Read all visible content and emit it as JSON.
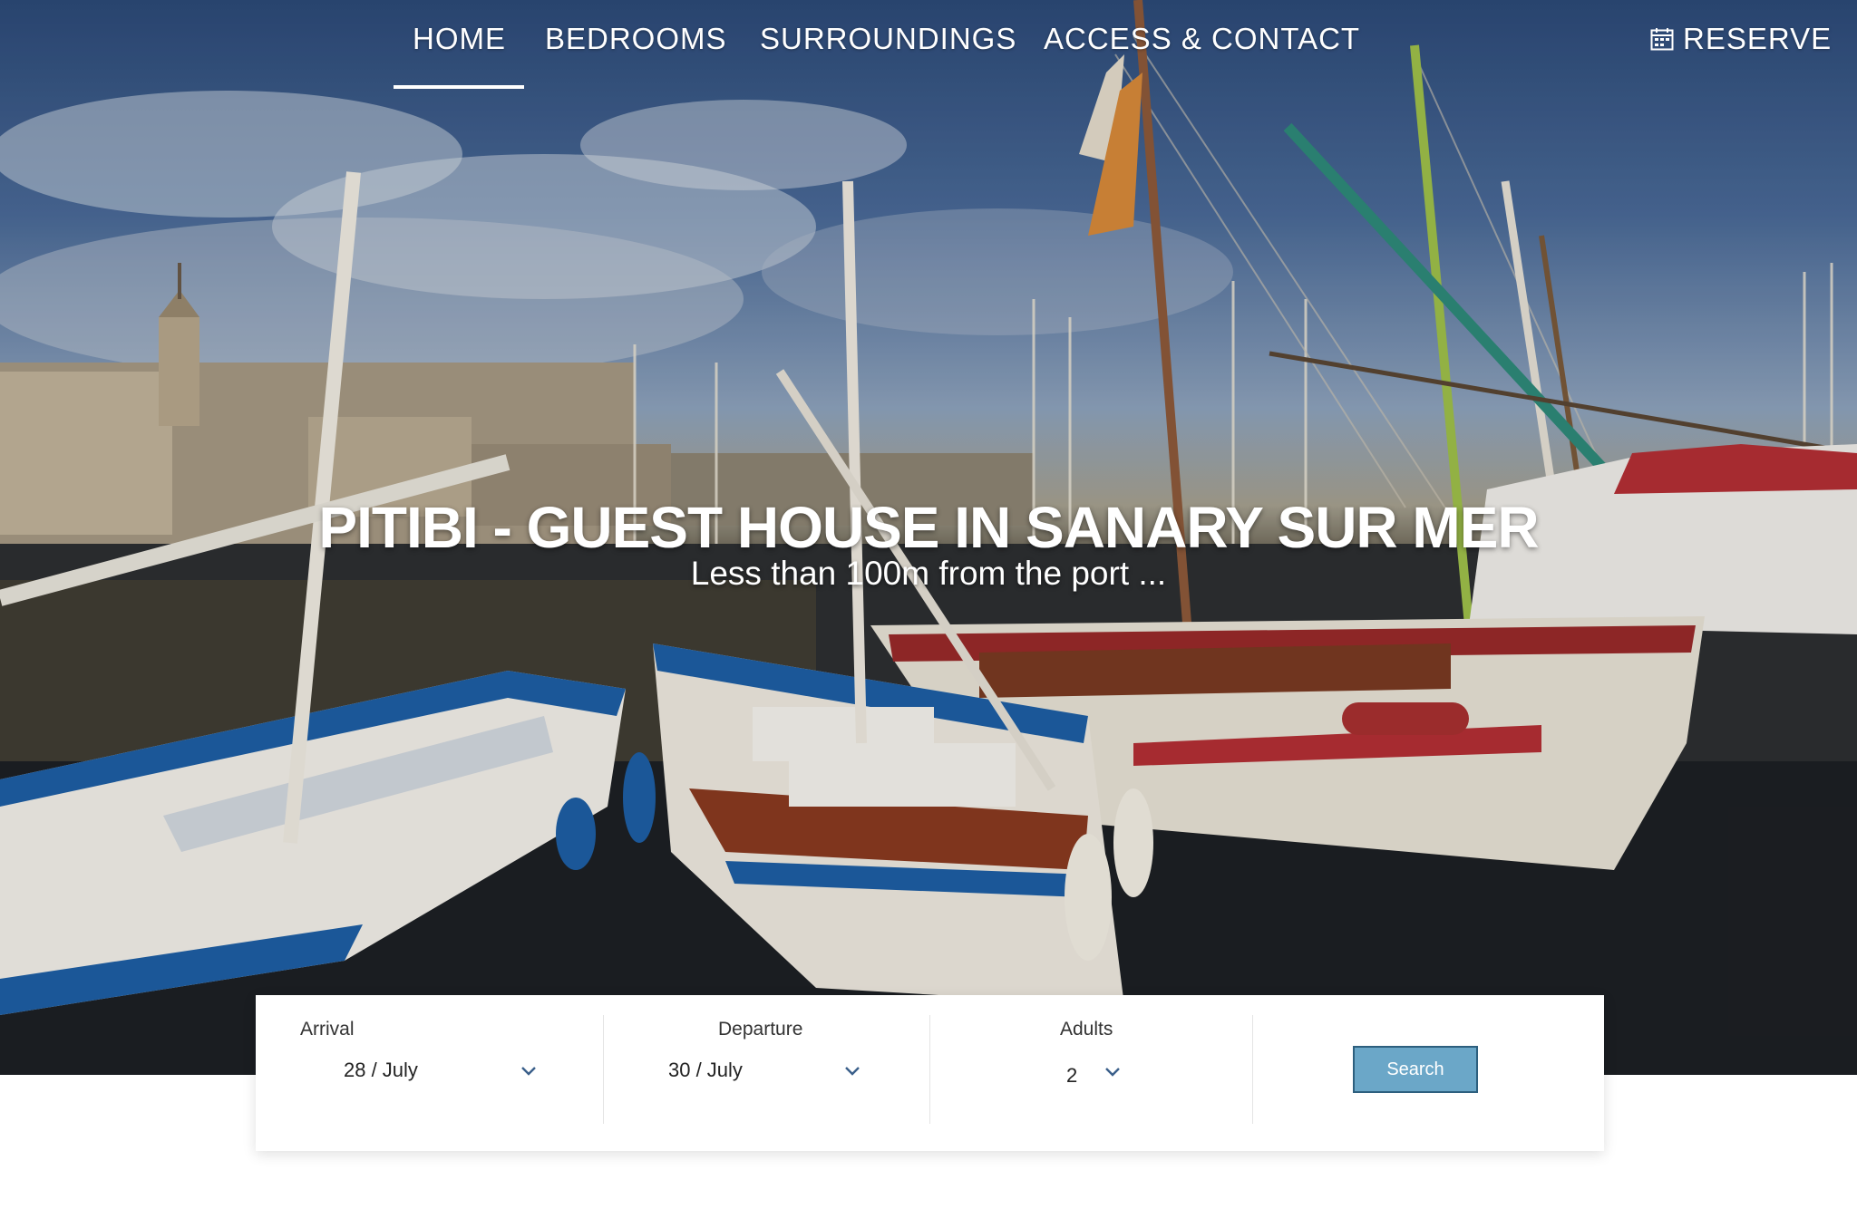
{
  "nav": {
    "items": [
      {
        "label": "HOME"
      },
      {
        "label": "BEDROOMS"
      },
      {
        "label": "SURROUNDINGS"
      },
      {
        "label": "ACCESS & CONTACT"
      }
    ],
    "active_index": 0,
    "reserve_label": "RESERVE",
    "reserve_icon": "calendar-icon"
  },
  "hero": {
    "title": "PITIBI - GUEST HOUSE IN SANARY SUR MER",
    "subtitle": "Less than 100m from the port ..."
  },
  "booking": {
    "arrival_label": "Arrival",
    "arrival_value": "28 / July",
    "departure_label": "Departure",
    "departure_value": "30 / July",
    "adults_label": "Adults",
    "adults_value": "2",
    "search_label": "Search"
  },
  "colors": {
    "search_button": "#6ba7c8",
    "search_border": "#2d5f7e",
    "nav_text": "#ffffff"
  }
}
